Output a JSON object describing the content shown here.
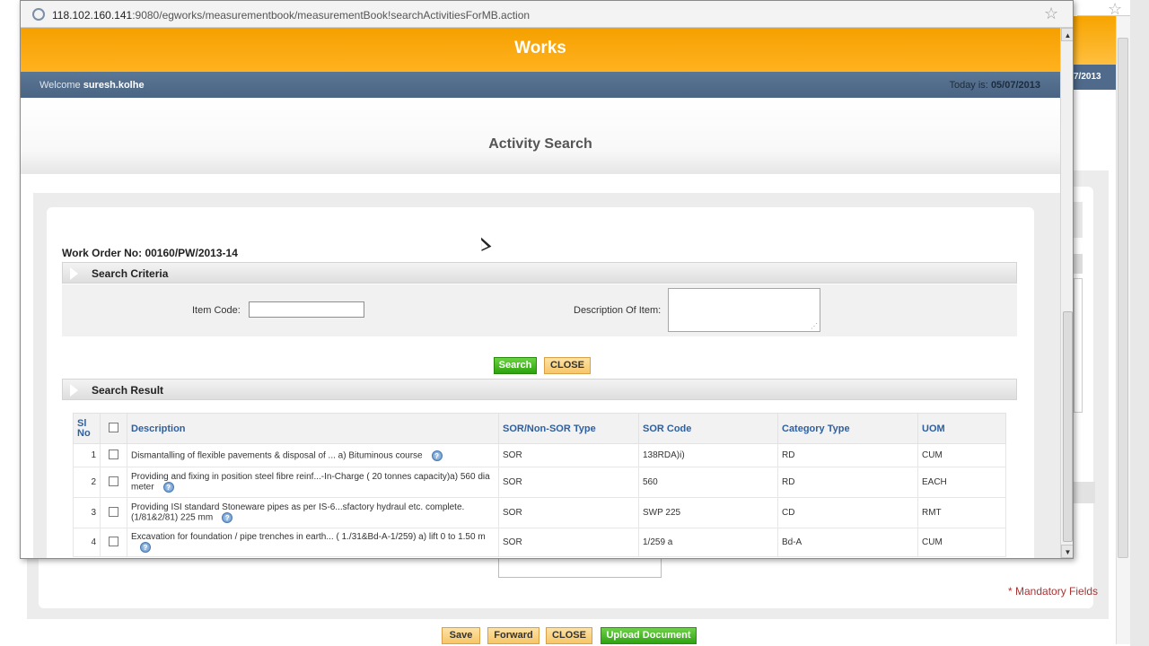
{
  "browser": {
    "url_host": "118.102.160.141",
    "url_rest": ":9080/egworks/measurementbook/measurementBook!searchActivitiesForMB.action"
  },
  "header": {
    "app_title": "Works",
    "welcome_prefix": "Welcome",
    "user": "suresh.kolhe",
    "today_prefix": "Today is:",
    "today_date": "05/07/2013"
  },
  "background": {
    "date_fragment": "7/2013",
    "mandatory_note": "* Mandatory Fields",
    "buttons": [
      "Save",
      "Forward",
      "CLOSE",
      "Upload Document"
    ]
  },
  "page": {
    "title": "Activity Search",
    "work_order": "Work Order No: 00160/PW/2013-14"
  },
  "search_criteria": {
    "heading": "Search Criteria",
    "item_code_label": "Item Code:",
    "item_code_value": "",
    "description_label": "Description Of Item:",
    "description_value": "",
    "search_button": "Search",
    "close_button": "CLOSE"
  },
  "search_result": {
    "heading": "Search Result",
    "columns": [
      "Sl No",
      "Description",
      "SOR/Non-SOR Type",
      "SOR Code",
      "Category Type",
      "UOM"
    ],
    "rows": [
      {
        "sl": "1",
        "description": "Dismantalling of flexible pavements & disposal of ... a) Bituminous course",
        "type": "SOR",
        "code": "138RDA)i)",
        "category": "RD",
        "uom": "CUM"
      },
      {
        "sl": "2",
        "description": "Providing and fixing in position steel fibre reinf...-In-Charge ( 20 tonnes capacity)a) 560 dia meter",
        "type": "SOR",
        "code": "560",
        "category": "RD",
        "uom": "EACH"
      },
      {
        "sl": "3",
        "description": "Providing ISI standard Stoneware pipes as per IS-6...sfactory hydraul etc. complete. (1/81&2/81) 225 mm",
        "type": "SOR",
        "code": "SWP 225",
        "category": "CD",
        "uom": "RMT"
      },
      {
        "sl": "4",
        "description": "Excavation for foundation / pipe trenches in earth... ( 1./31&Bd-A-1/259) a) lift 0 to 1.50 m",
        "type": "SOR",
        "code": "1/259 a",
        "category": "Bd-A",
        "uom": "CUM"
      }
    ]
  },
  "colors": {
    "header_orange": "#f5a000",
    "header_blue": "#4f6a8a",
    "button_green": "#2ba30c",
    "column_blue": "#2f5f9e"
  }
}
